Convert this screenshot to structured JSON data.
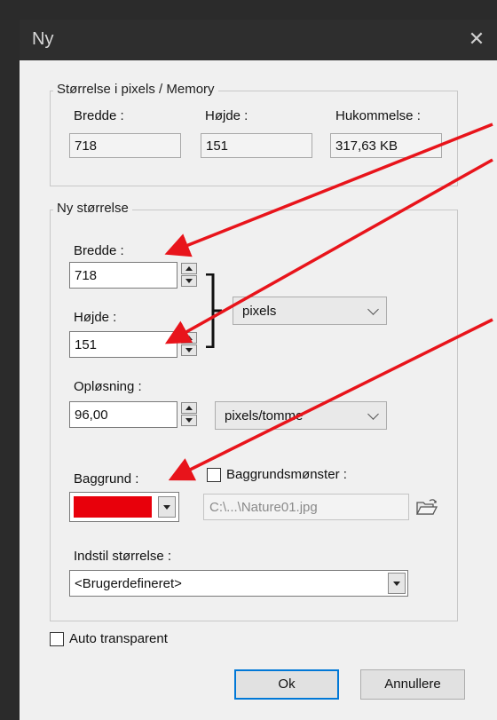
{
  "window": {
    "title": "Ny",
    "close_glyph": "✕"
  },
  "memory_group": {
    "legend": "Størrelse i pixels / Memory",
    "width_label": "Bredde :",
    "height_label": "Højde :",
    "memory_label": "Hukommelse :",
    "width_value": "718",
    "height_value": "151",
    "memory_value": "317,63 KB"
  },
  "new_size_group": {
    "legend": "Ny størrelse",
    "width_label": "Bredde :",
    "width_value": "718",
    "height_label": "Højde :",
    "height_value": "151",
    "unit_selected": "pixels",
    "resolution_label": "Opløsning :",
    "resolution_value": "96,00",
    "resolution_unit_selected": "pixels/tomme",
    "background_label": "Baggrund :",
    "background_color": "#e8000b",
    "pattern_label": "Baggrundsmønster :",
    "pattern_checked": false,
    "pattern_path": "C:\\...\\Nature01.jpg",
    "preset_label": "Indstil størrelse :",
    "preset_selected": "<Brugerdefineret>"
  },
  "auto_transparent": {
    "label": "Auto transparent",
    "checked": false
  },
  "buttons": {
    "ok": "Ok",
    "cancel": "Annullere"
  },
  "colors": {
    "arrow": "#e8141b",
    "titlebar": "#2e2e2e",
    "dialog_bg": "#f0f0f0",
    "ok_border": "#0078d7"
  }
}
